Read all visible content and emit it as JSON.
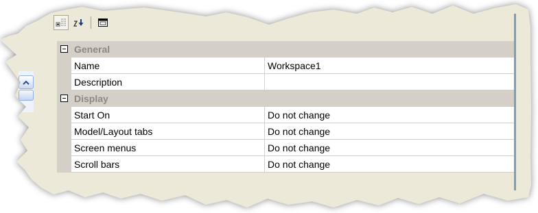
{
  "toolbar": {
    "buttons": [
      {
        "icon": "categorized-view-icon",
        "active": true
      },
      {
        "icon": "sort-alphabetical-icon",
        "active": false
      },
      {
        "icon": "property-pages-icon",
        "active": false
      }
    ]
  },
  "colors": {
    "background": "#ece9d8",
    "category_band": "#d4d0c8",
    "category_text": "#8c8a80",
    "gridline": "#d4d0c8",
    "cell": "#ffffff"
  },
  "categories": [
    {
      "label": "General",
      "properties": [
        {
          "name": "Name",
          "value": "Workspace1"
        },
        {
          "name": "Description",
          "value": ""
        }
      ]
    },
    {
      "label": "Display",
      "properties": [
        {
          "name": "Start On",
          "value": "Do not change"
        },
        {
          "name": "Model/Layout tabs",
          "value": "Do not change"
        },
        {
          "name": "Screen menus",
          "value": "Do not change"
        },
        {
          "name": "Scroll bars",
          "value": "Do not change"
        }
      ]
    }
  ]
}
